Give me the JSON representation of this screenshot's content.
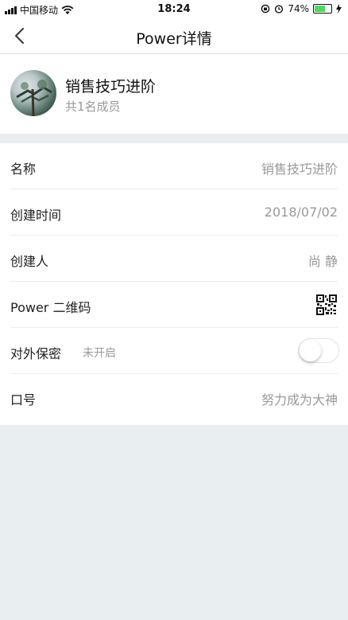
{
  "status_bar": {
    "carrier": "中国移动",
    "time": "18:24",
    "battery": "74%",
    "battery_level": 0.74
  },
  "nav": {
    "title": "Power详情"
  },
  "group": {
    "name": "销售技巧进阶",
    "members": "共1名成员"
  },
  "rows": {
    "name": {
      "label": "名称",
      "value": "销售技巧进阶"
    },
    "created_time": {
      "label": "创建时间",
      "value": "2018/07/02"
    },
    "creator": {
      "label": "创建人",
      "value": "尚 静"
    },
    "qrcode": {
      "label": "Power 二维码",
      "icon": "qr-code-icon"
    },
    "privacy": {
      "label": "对外保密",
      "status": "未开启",
      "enabled": false
    },
    "password": {
      "label": "口号",
      "value": "努力成为大神"
    }
  },
  "colors": {
    "background": "#e9eef1",
    "secondary_text": "#999999",
    "battery_green": "#4cd964"
  }
}
